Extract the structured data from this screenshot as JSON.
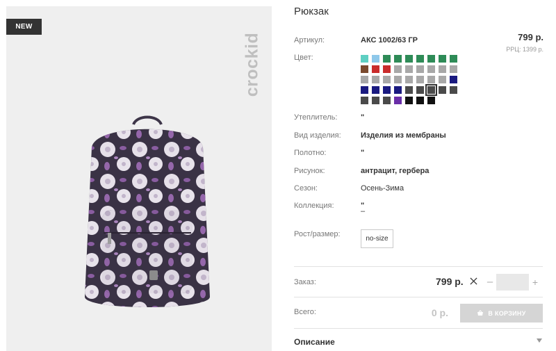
{
  "product": {
    "badge": "NEW",
    "brand": "crockid",
    "title": "Рюкзак"
  },
  "labels": {
    "article": "Артикул:",
    "color": "Цвет:",
    "insulation": "Утеплитель:",
    "item_type": "Вид изделия:",
    "fabric": "Полотно:",
    "pattern": "Рисунок:",
    "season": "Сезон:",
    "collection": "Коллекция:",
    "size": "Рост/размер:",
    "order": "Заказ:",
    "total": "Всего:",
    "description": "Описание"
  },
  "values": {
    "article": "АКС 1002/63 ГР",
    "insulation": "\"",
    "item_type": "Изделия из мембраны",
    "fabric": "\"",
    "pattern": "антрацит, гербера",
    "season": "Осень-Зима",
    "collection_line1": "\"",
    "collection_line2": "–"
  },
  "price": {
    "main": "799 р.",
    "rrp": "РРЦ: 1399 р."
  },
  "swatches": [
    "#5ecfc2",
    "#8ec8ea",
    "#2e8b57",
    "#2e8b57",
    "#2e8b57",
    "#2e8b57",
    "#2e8b57",
    "#2e8b57",
    "#2e8b57",
    "#7a4a2e",
    "#c92c2c",
    "#c92c2c",
    "#a8a8a8",
    "#a8a8a8",
    "#a8a8a8",
    "#a8a8a8",
    "#a8a8a8",
    "#a8a8a8",
    "#a8a8a8",
    "#a8a8a8",
    "#a8a8a8",
    "#a8a8a8",
    "#a8a8a8",
    "#a8a8a8",
    "#a8a8a8",
    "#a8a8a8",
    "#1a1a80",
    "#1a1a80",
    "#1a1a80",
    "#1a1a80",
    "#1a1a80",
    "#4a4a4a",
    "#4a4a4a",
    "#4a4a4a",
    "#4a4a4a",
    "#4a4a4a",
    "#4a4a4a",
    "#4a4a4a",
    "#4a4a4a",
    "#6a2ea8",
    "#111111",
    "#111111",
    "#111111"
  ],
  "selected_swatch_index": 33,
  "size": {
    "selected": "no-size"
  },
  "order": {
    "price": "799 р.",
    "minus": "–",
    "plus": "+",
    "quantity": ""
  },
  "total": {
    "value": "0 р.",
    "cart_label": "В КОРЗИНУ"
  },
  "colors": {
    "badge_bg": "#333333",
    "cart_disabled": "#d5d5d5",
    "image_bg": "#efefef"
  },
  "icons": {
    "close": "close-icon",
    "cart": "basket-icon",
    "arrow": "chevron-down-icon",
    "brand": "crockid-logo-icon"
  }
}
